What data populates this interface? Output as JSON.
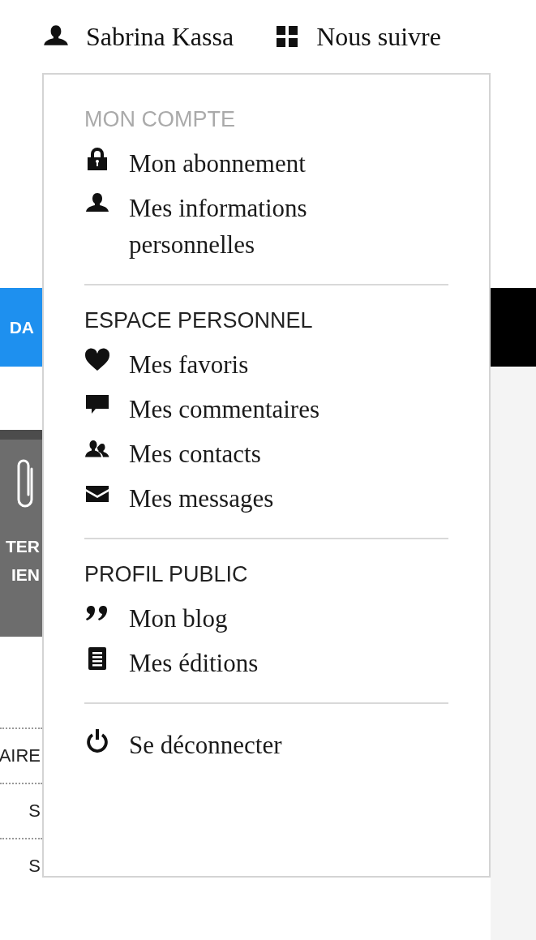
{
  "top_bar": {
    "user_name": "Sabrina Kassa",
    "follow_link": "Nous suivre"
  },
  "background": {
    "nav_text": "DA",
    "side_button": [
      "TER",
      "IEN"
    ],
    "list_items": [
      "AIRE",
      "S",
      "S"
    ]
  },
  "dropdown": {
    "sections": [
      {
        "heading": "MON COMPTE",
        "muted": true,
        "items": [
          {
            "label": "Mon abonnement"
          },
          {
            "label": "Mes informations personnelles"
          }
        ]
      },
      {
        "heading": "ESPACE PERSONNEL",
        "muted": false,
        "items": [
          {
            "label": "Mes favoris"
          },
          {
            "label": "Mes commentaires"
          },
          {
            "label": "Mes contacts"
          },
          {
            "label": "Mes messages"
          }
        ]
      },
      {
        "heading": "PROFIL PUBLIC",
        "muted": false,
        "items": [
          {
            "label": "Mon blog"
          },
          {
            "label": "Mes éditions"
          }
        ]
      },
      {
        "items": [
          {
            "label": "Se déconnecter"
          }
        ]
      }
    ]
  }
}
